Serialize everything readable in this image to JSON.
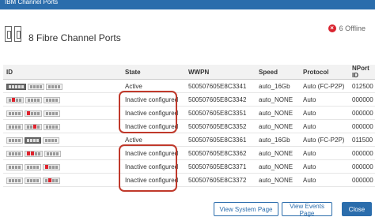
{
  "window": {
    "title": "IBM Channel Ports"
  },
  "header": {
    "title": "8 Fibre Channel Ports",
    "offline_label": "6 Offline"
  },
  "table": {
    "columns": [
      "ID",
      "State",
      "WWPN",
      "Speed",
      "Protocol",
      "NPort ID"
    ],
    "rows": [
      {
        "state": "Active",
        "wwpn": "500507605E8C3341",
        "speed": "auto_16Gb",
        "protocol": "Auto (FC-P2P)",
        "nport": "012500"
      },
      {
        "state": "Inactive configured",
        "wwpn": "500507605E8C3342",
        "speed": "auto_NONE",
        "protocol": "Auto",
        "nport": "000000"
      },
      {
        "state": "Inactive configured",
        "wwpn": "500507605E8C3351",
        "speed": "auto_NONE",
        "protocol": "Auto",
        "nport": "000000"
      },
      {
        "state": "Inactive configured",
        "wwpn": "500507605E8C3352",
        "speed": "auto_NONE",
        "protocol": "Auto",
        "nport": "000000"
      },
      {
        "state": "Active",
        "wwpn": "500507605E8C3361",
        "speed": "auto_16Gb",
        "protocol": "Auto (FC-P2P)",
        "nport": "011500"
      },
      {
        "state": "Inactive configured",
        "wwpn": "500507605E8C3362",
        "speed": "auto_NONE",
        "protocol": "Auto",
        "nport": "000000"
      },
      {
        "state": "Inactive configured",
        "wwpn": "500507605E8C3371",
        "speed": "auto_NONE",
        "protocol": "Auto",
        "nport": "000000"
      },
      {
        "state": "Inactive configured",
        "wwpn": "500507605E8C3372",
        "speed": "auto_NONE",
        "protocol": "Auto",
        "nport": "000000"
      }
    ]
  },
  "footer": {
    "view_system": "View System Page",
    "view_events": "View Events Page",
    "close": "Close"
  },
  "colors": {
    "accent": "#2b6dac",
    "error": "#d9232e",
    "highlight": "#c0392b"
  },
  "icons": {
    "ports": "fibre-channel-ports-icon",
    "offline": "offline-x-icon"
  }
}
